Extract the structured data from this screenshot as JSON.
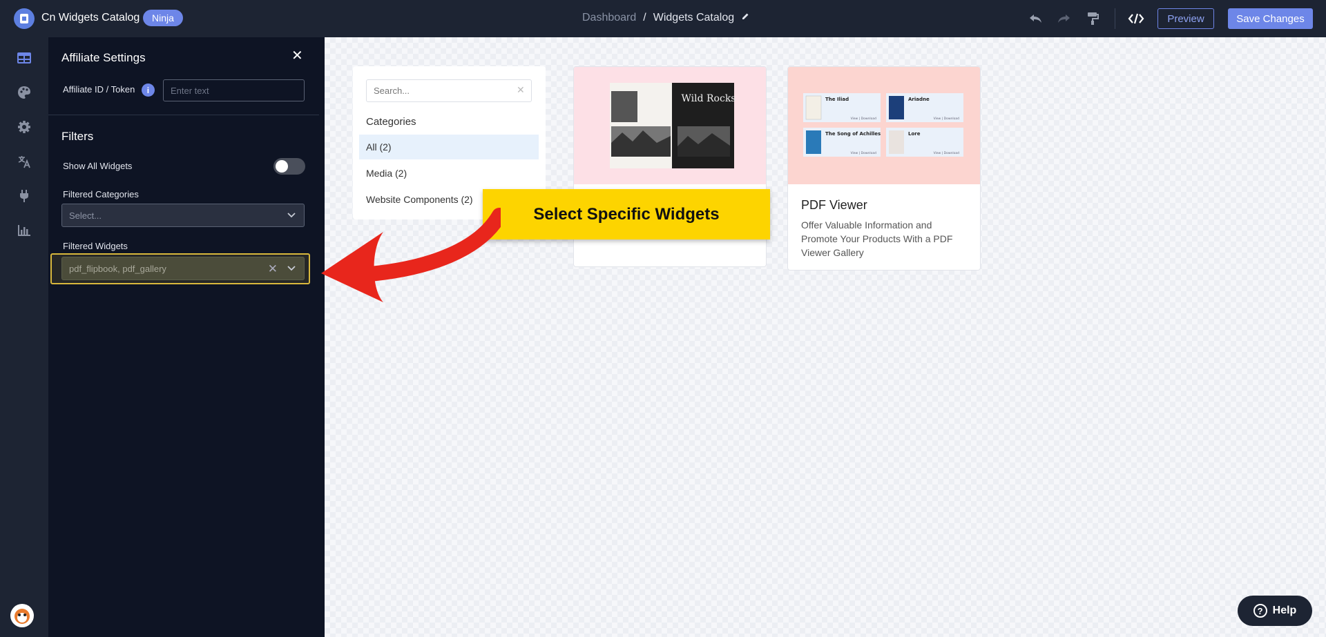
{
  "topbar": {
    "app_title": "Cn Widgets Catalog",
    "badge": "Ninja",
    "breadcrumb_root": "Dashboard",
    "breadcrumb_separator": "/",
    "breadcrumb_current": "Widgets Catalog",
    "preview_label": "Preview",
    "save_label": "Save Changes"
  },
  "rail": {
    "icons": [
      "layout-icon",
      "palette-icon",
      "gear-icon",
      "translate-icon",
      "plug-icon",
      "chart-icon"
    ]
  },
  "panel": {
    "title": "Affiliate Settings",
    "affiliate_label": "Affiliate ID / Token",
    "affiliate_placeholder": "Enter text",
    "filters_title": "Filters",
    "show_all_label": "Show All Widgets",
    "show_all_on": false,
    "filtered_categories_label": "Filtered Categories",
    "filtered_categories_placeholder": "Select...",
    "filtered_widgets_label": "Filtered Widgets",
    "filtered_widgets_value": "pdf_flipbook, pdf_gallery"
  },
  "catalog": {
    "search_placeholder": "Search...",
    "categories_title": "Categories",
    "categories": [
      {
        "label": "All (2)",
        "active": true
      },
      {
        "label": "Media (2)",
        "active": false
      },
      {
        "label": "Website Components (2)",
        "active": false
      }
    ],
    "cards": [
      {
        "title": "",
        "description": "",
        "thumb_color": "#fde0e6"
      },
      {
        "title": "PDF Viewer",
        "description": "Offer Valuable Information and Promote Your Products With a PDF Viewer Gallery",
        "thumb_color": "#fcd5d0"
      }
    ],
    "book_title": "Wild Rocks",
    "pdf_items": [
      {
        "title": "The Iliad",
        "actions": "View | Download"
      },
      {
        "title": "Ariadne",
        "actions": "View | Download"
      },
      {
        "title": "The Song of Achilles",
        "actions": "View | Download"
      },
      {
        "title": "Lore",
        "actions": "View | Download"
      }
    ]
  },
  "callout": "Select Specific Widgets",
  "help_label": "Help",
  "colors": {
    "accent": "#6d86e8",
    "topbar": "#1d2433",
    "panel": "#0e1424",
    "callout": "#fdd400",
    "arrow": "#e8261c"
  }
}
